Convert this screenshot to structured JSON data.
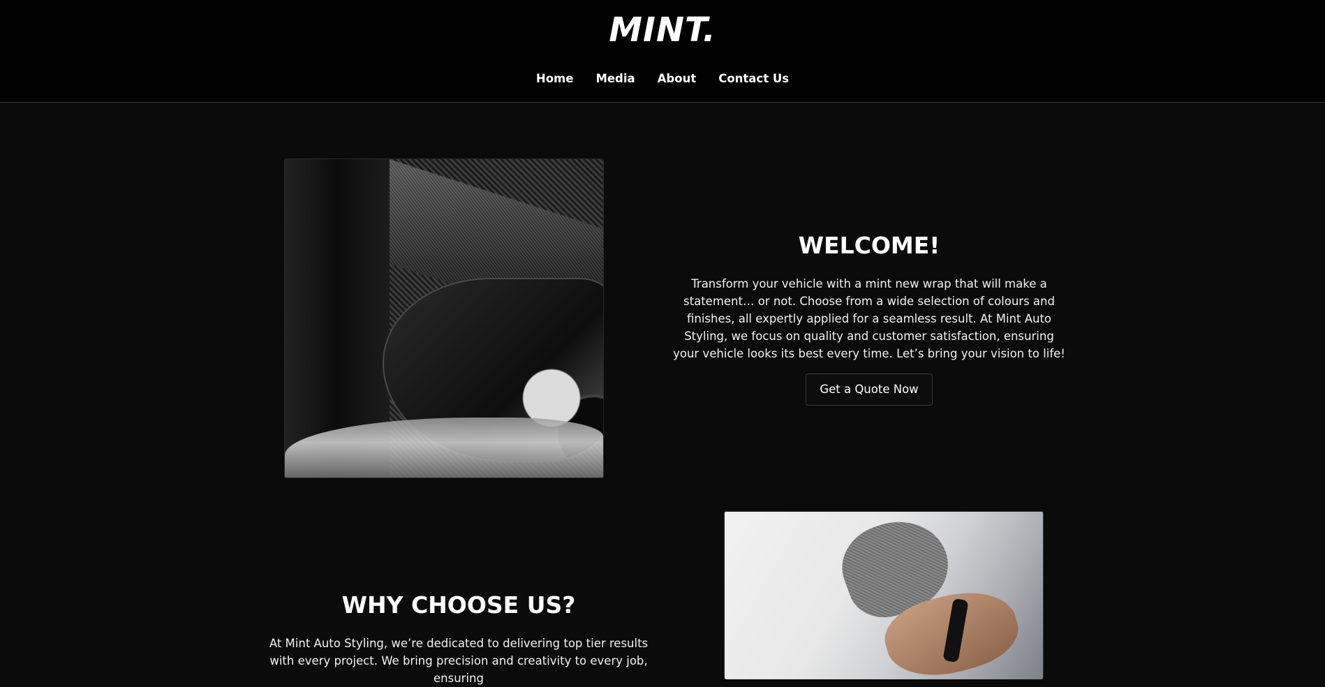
{
  "header": {
    "logo": "MINT.",
    "nav": [
      {
        "label": "Home"
      },
      {
        "label": "Media"
      },
      {
        "label": "About"
      },
      {
        "label": "Contact Us"
      }
    ]
  },
  "welcome": {
    "image_alt": "carbon-fibre wrapped car headlight",
    "heading": "WELCOME!",
    "body": "Transform your vehicle with a mint new wrap that will make a statement… or not. Choose from a wide selection of colours and finishes, all expertly applied for a seamless result. At Mint Auto Styling, we focus on quality and customer satisfaction, ensuring your vehicle looks its best every time. Let’s bring your vision to life!",
    "cta_label": "Get a Quote Now"
  },
  "why": {
    "heading": "WHY CHOOSE US?",
    "body": "At Mint Auto Styling, we’re dedicated to delivering top tier results with every project. We bring precision and creativity to every job, ensuring",
    "image_alt": "gloved hands applying vinyl wrap"
  },
  "colors": {
    "header_bg": "#000000",
    "page_bg": "#0b0b0b",
    "text": "#ffffff",
    "button_border": "#3a3a3a"
  }
}
